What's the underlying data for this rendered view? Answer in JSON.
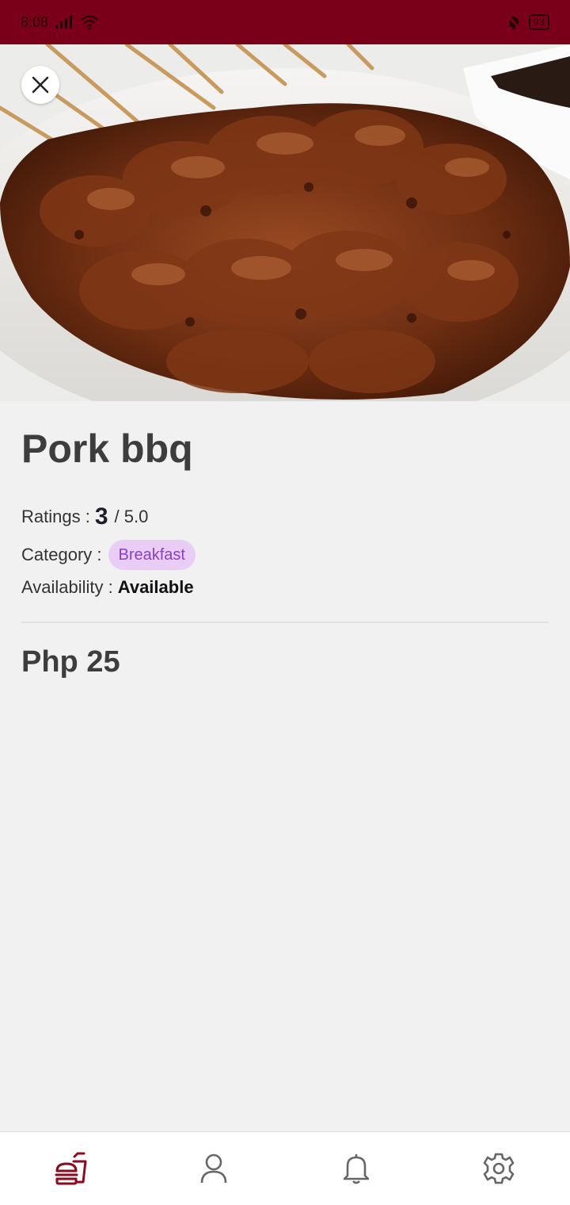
{
  "status_bar": {
    "time": "8:08",
    "battery": "93"
  },
  "item": {
    "name": "Pork bbq",
    "ratings_label": "Ratings :",
    "rating_value": "3",
    "rating_max": "/ 5.0",
    "category_label": "Category :",
    "category": "Breakfast",
    "availability_label": "Availability :",
    "availability": "Available",
    "price": "Php 25"
  },
  "bottom_nav": [
    {
      "icon": "food-icon",
      "active": true
    },
    {
      "icon": "profile-icon",
      "active": false
    },
    {
      "icon": "bell-icon",
      "active": false
    },
    {
      "icon": "settings-icon",
      "active": false
    }
  ],
  "colors": {
    "status_bar": "#7a0019",
    "nav_active": "#8b0a1e",
    "nav_inactive": "#666666",
    "badge_bg": "#e9cdf7",
    "badge_text": "#8a3fc4"
  }
}
